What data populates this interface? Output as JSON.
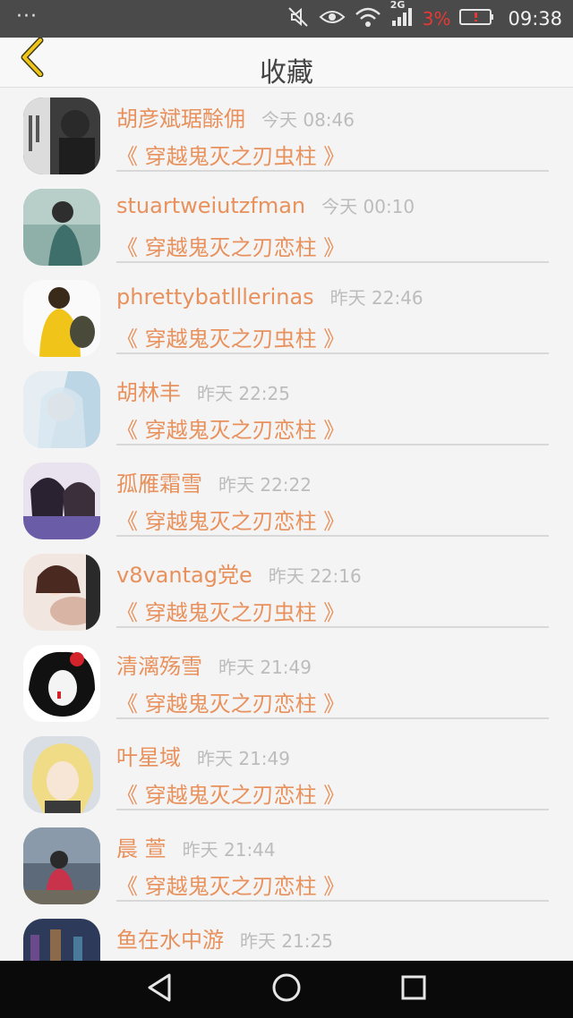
{
  "statusbar": {
    "dots": "···",
    "network_label": "2G",
    "battery_percent": "3%",
    "time": "09:38",
    "icons": [
      "mute-icon",
      "eye-icon",
      "wifi-icon",
      "signal-icon",
      "battery-icon"
    ]
  },
  "header": {
    "title": "收藏",
    "back_icon": "chevron-left-icon"
  },
  "favorites": [
    {
      "user": "胡彦斌琚酴佣",
      "time": "今天 08:46",
      "book": "《 穿越鬼灭之刃虫柱 》"
    },
    {
      "user": "stuartweiutzfman",
      "time": "今天 00:10",
      "book": "《 穿越鬼灭之刃恋柱 》"
    },
    {
      "user": "phrettybatlllerinas",
      "time": "昨天 22:46",
      "book": "《 穿越鬼灭之刃虫柱 》"
    },
    {
      "user": "胡林丰",
      "time": "昨天 22:25",
      "book": "《 穿越鬼灭之刃恋柱 》"
    },
    {
      "user": "孤雁霜雪",
      "time": "昨天 22:22",
      "book": "《 穿越鬼灭之刃恋柱 》"
    },
    {
      "user": "v8vantag党e",
      "time": "昨天 22:16",
      "book": "《 穿越鬼灭之刃虫柱 》"
    },
    {
      "user": "清漓殇雪",
      "time": "昨天 21:49",
      "book": "《 穿越鬼灭之刃恋柱 》"
    },
    {
      "user": "叶星域",
      "time": "昨天 21:49",
      "book": "《 穿越鬼灭之刃恋柱 》"
    },
    {
      "user": "晨 萱",
      "time": "昨天 21:44",
      "book": "《 穿越鬼灭之刃恋柱 》"
    },
    {
      "user": "鱼在水中游",
      "time": "昨天 21:25",
      "book": ""
    }
  ],
  "navbar": {
    "icons": [
      "back-triangle-icon",
      "home-circle-icon",
      "recents-square-icon"
    ]
  },
  "colors": {
    "accent": "#e8915c",
    "timestamp": "#bcbcbc",
    "back_chevron": "#f0c419",
    "battery_low": "#e53935"
  }
}
